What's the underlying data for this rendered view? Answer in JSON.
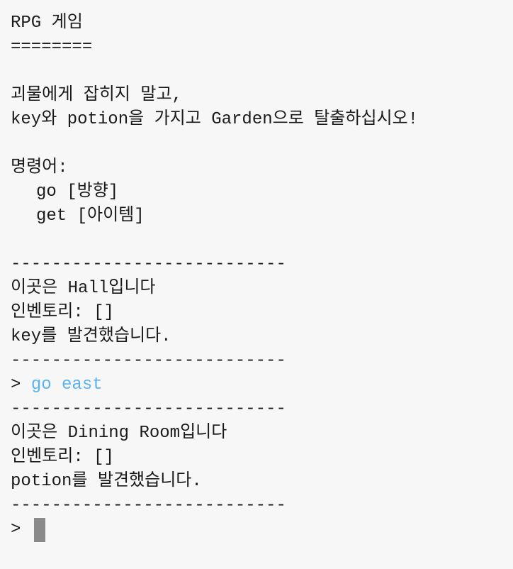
{
  "title": "RPG 게임",
  "title_underline": "========",
  "intro": [
    "괴물에게 잡히지 말고,",
    "key와 potion을 가지고 Garden으로 탈출하십시오!"
  ],
  "commands_header": "명령어:",
  "commands": [
    "go [방향]",
    "get [아이템]"
  ],
  "separator": "---------------------------",
  "log": [
    {
      "location": "이곳은 Hall입니다",
      "inventory": "인벤토리: []",
      "found": "key를 발견했습니다."
    },
    {
      "location": "이곳은 Dining Room입니다",
      "inventory": "인벤토리: []",
      "found": "potion를 발견했습니다."
    }
  ],
  "prompt_symbol": "> ",
  "entered_command": "go east",
  "colors": {
    "background": "#f7f7f7",
    "text": "#1a1a1a",
    "command": "#59b3f5",
    "cursor": "#8a8a8a"
  }
}
